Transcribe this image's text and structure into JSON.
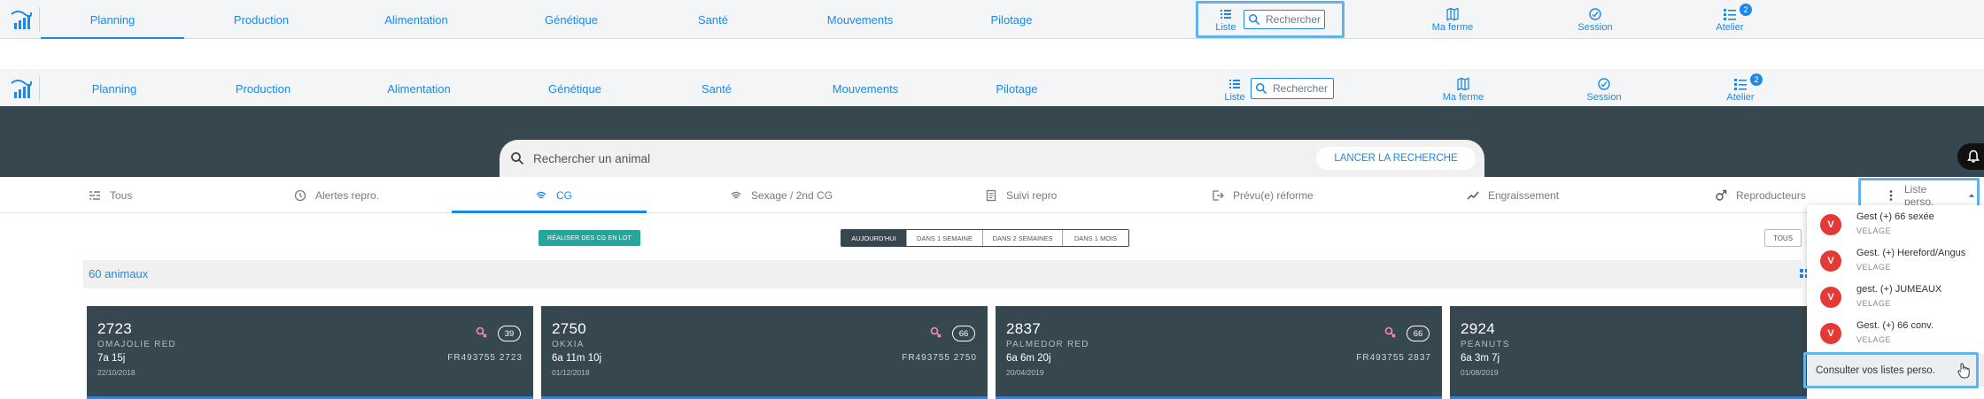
{
  "nav": {
    "items": [
      "Planning",
      "Production",
      "Alimentation",
      "Génétique",
      "Santé",
      "Mouvements",
      "Pilotage"
    ],
    "liste_label": "Liste",
    "search_placeholder": "Rechercher",
    "ma_ferme_label": "Ma ferme",
    "session_label": "Session",
    "atelier_label": "Atelier",
    "atelier_badge": "2"
  },
  "search": {
    "placeholder": "Rechercher un animal",
    "launch_label": "LANCER LA RECHERCHE"
  },
  "tabs": {
    "tous": "Tous",
    "alertes": "Alertes repro.",
    "cg": "CG",
    "sexage": "Sexage / 2nd CG",
    "suivi": "Suivi repro",
    "prevu": "Prévu(e) réforme",
    "engraissement": "Engraissement",
    "reproducteurs": "Reproducteurs",
    "liste_perso": "Liste perso."
  },
  "toolbar": {
    "lot_button": "RÉALISER DES CG EN LOT",
    "periods": [
      "AUJOURD'HUI",
      "DANS 1 SEMAINE",
      "DANS 2 SEMAINES",
      "DANS 1 MOIS"
    ],
    "tous_button": "TOUS"
  },
  "count_label": "60 animaux",
  "cards": [
    {
      "num": "2723",
      "name": "OMAJOLIE RED",
      "age": "7a 15j",
      "date": "22/10/2018",
      "fr": "FR493755 2723",
      "badge": "39"
    },
    {
      "num": "2750",
      "name": "OKXIA",
      "age": "6a 11m 10j",
      "date": "01/12/2018",
      "fr": "FR493755 2750",
      "badge": "66"
    },
    {
      "num": "2837",
      "name": "PALMEDOR RED",
      "age": "6a 6m 20j",
      "date": "20/04/2019",
      "fr": "FR493755 2837",
      "badge": "66"
    },
    {
      "num": "2924",
      "name": "PEANUTS",
      "age": "6a 3m 7j",
      "date": "01/08/2019",
      "fr": "",
      "badge": ""
    }
  ],
  "dropdown": {
    "items": [
      {
        "avatar": "V",
        "title": "Gest (+) 66 sexée",
        "subtitle": "VELAGE"
      },
      {
        "avatar": "V",
        "title": "Gest. (+) Hereford/Angus",
        "subtitle": "VELAGE"
      },
      {
        "avatar": "V",
        "title": "gest. (+) JUMEAUX",
        "subtitle": "VELAGE"
      },
      {
        "avatar": "V",
        "title": "Gest. (+) 66 conv.",
        "subtitle": "VELAGE"
      }
    ],
    "consult_label": "Consulter vos listes perso."
  },
  "colors": {
    "accent": "#1e88e5",
    "dark": "#37474f",
    "green": "#26a69a",
    "avatar_red": "#e53935",
    "highlight": "#62b3ec"
  }
}
